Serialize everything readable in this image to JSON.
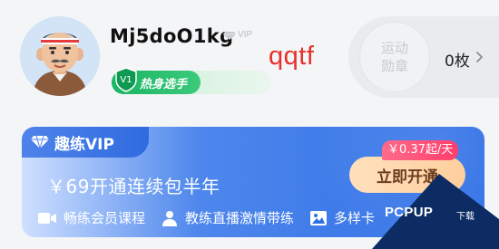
{
  "profile": {
    "username": "Mj5doO1kg",
    "vip_tag": "VIP",
    "level_label": "热身选手",
    "overlay_text": "qqtf"
  },
  "medal": {
    "label": "运动勋章",
    "count": "0枚"
  },
  "vip_card": {
    "title": "趣练VIP",
    "price_text": "￥69开通连续包半年",
    "daily_price": "￥0.37起/天",
    "cta_label": "立即开通",
    "perks": [
      {
        "icon": "video-icon",
        "label": "畅练会员课程"
      },
      {
        "icon": "coach-icon",
        "label": "教练直播激情带练"
      },
      {
        "icon": "image-icon",
        "label": "多样卡"
      }
    ]
  },
  "corner_logo": {
    "text": "PCPUP",
    "sub": "下载"
  },
  "colors": {
    "level_green": "#18b564",
    "vip_blue": "#2f6fe6",
    "cta_orange": "#ffcf9d",
    "price_badge_pink": "#ff3f6c",
    "overlay_red": "#e8302a"
  }
}
